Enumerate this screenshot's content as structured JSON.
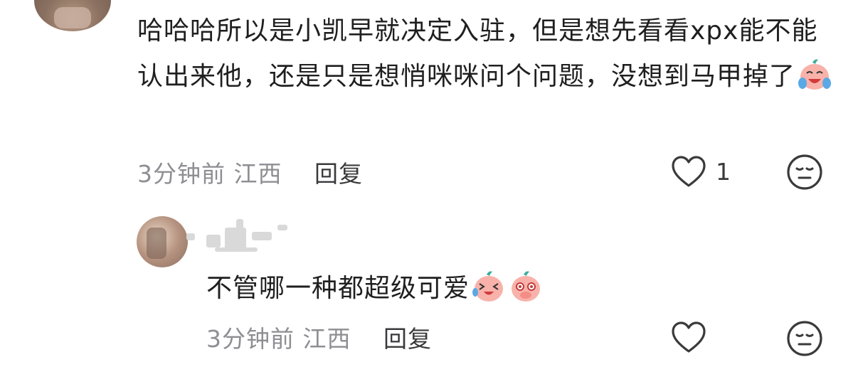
{
  "top_comment": {
    "text": "哈哈哈所以是小凯早就决定入驻，但是想先看看xpx能不能认出来他，还是只是想悄咪咪问个问题，没想到马甲掉了",
    "emoji": "crying-laughing-peach-emoji",
    "time": "3分钟前",
    "location": "江西",
    "reply_label": "回复",
    "like_count": "1"
  },
  "reply_comment": {
    "text": "不管哪一种都超级可爱",
    "emojis": [
      "laughing-peach-emoji",
      "pleading-peach-emoji"
    ],
    "time": "3分钟前",
    "location": "江西",
    "reply_label": "回复"
  },
  "icons": {
    "like": "heart-outline-icon",
    "dislike": "neutral-face-icon"
  },
  "colors": {
    "text": "#1f1f1f",
    "meta": "#8e8e93",
    "emoji_peach": "#f6a7a0"
  }
}
